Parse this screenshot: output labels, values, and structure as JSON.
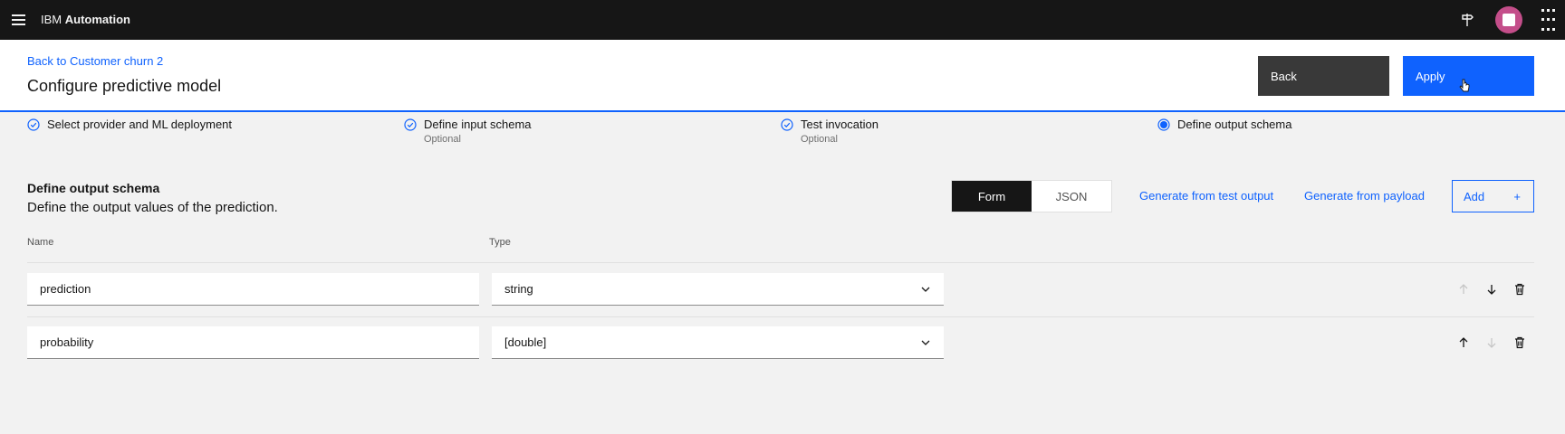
{
  "app": {
    "brand_prefix": "IBM",
    "brand_name": "Automation"
  },
  "header": {
    "breadcrumb": "Back to Customer churn 2",
    "title": "Configure predictive model",
    "back_label": "Back",
    "apply_label": "Apply"
  },
  "steps": [
    {
      "label": "Select provider and ML deployment",
      "sub": "",
      "status": "complete"
    },
    {
      "label": "Define input schema",
      "sub": "Optional",
      "status": "complete"
    },
    {
      "label": "Test invocation",
      "sub": "Optional",
      "status": "complete"
    },
    {
      "label": "Define output schema",
      "sub": "",
      "status": "current"
    }
  ],
  "section": {
    "title": "Define output schema",
    "description": "Define the output values of the prediction."
  },
  "toggle": {
    "form": "Form",
    "json": "JSON",
    "active": "Form"
  },
  "actions": {
    "generate_test": "Generate from test output",
    "generate_payload": "Generate from payload",
    "add": "Add",
    "add_icon": "+"
  },
  "columns": {
    "name": "Name",
    "type": "Type"
  },
  "rows": [
    {
      "name": "prediction",
      "type": "string"
    },
    {
      "name": "probability",
      "type": "[double]"
    }
  ],
  "colors": {
    "accent": "#0f62fe",
    "topbar": "#161616",
    "avatar": "#c44e8a"
  }
}
